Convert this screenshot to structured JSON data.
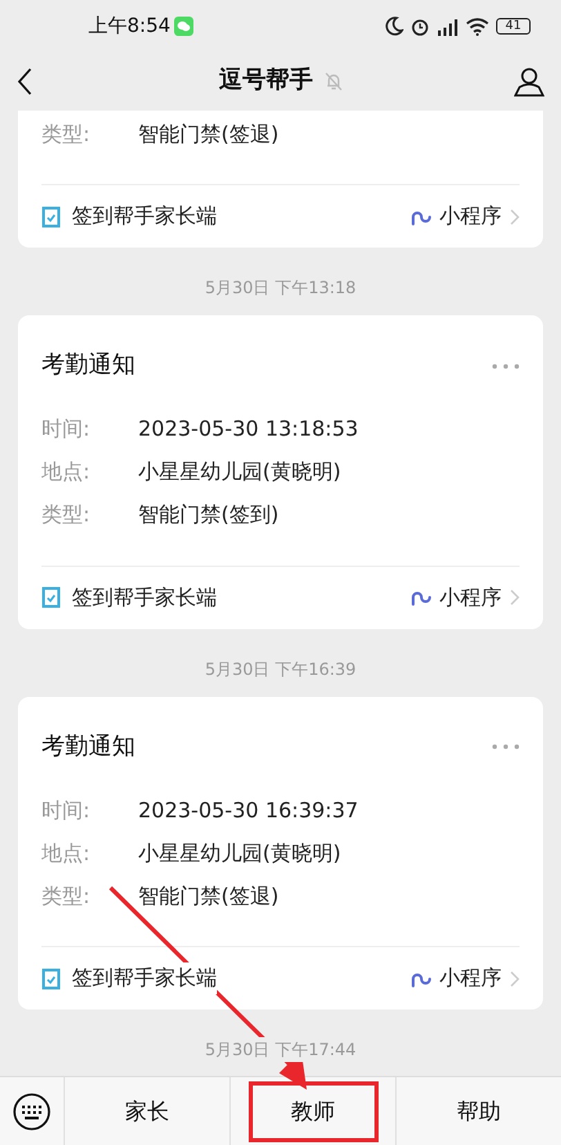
{
  "status_bar": {
    "time": "上午8:54",
    "battery": "41"
  },
  "header": {
    "title": "逗号帮手"
  },
  "messages": [
    {
      "fields": [
        {
          "label": "类型:",
          "value": "智能门禁(签退)"
        }
      ],
      "footer": {
        "app": "签到帮手家长端",
        "tag": "小程序"
      }
    },
    {
      "timestamp": "5月30日 下午13:18",
      "title": "考勤通知",
      "fields": [
        {
          "label": "时间:",
          "value": "2023-05-30 13:18:53"
        },
        {
          "label": "地点:",
          "value": "小星星幼儿园(黄晓明)"
        },
        {
          "label": "类型:",
          "value": "智能门禁(签到)"
        }
      ],
      "footer": {
        "app": "签到帮手家长端",
        "tag": "小程序"
      }
    },
    {
      "timestamp": "5月30日 下午16:39",
      "title": "考勤通知",
      "fields": [
        {
          "label": "时间:",
          "value": "2023-05-30 16:39:37"
        },
        {
          "label": "地点:",
          "value": "小星星幼儿园(黄晓明)"
        },
        {
          "label": "类型:",
          "value": "智能门禁(签退)"
        }
      ],
      "footer": {
        "app": "签到帮手家长端",
        "tag": "小程序"
      }
    }
  ],
  "cut_timestamp": "5月30日 下午17:44",
  "menu": [
    {
      "label": "家长",
      "highlighted": false
    },
    {
      "label": "教师",
      "highlighted": true
    },
    {
      "label": "帮助",
      "highlighted": false
    }
  ]
}
